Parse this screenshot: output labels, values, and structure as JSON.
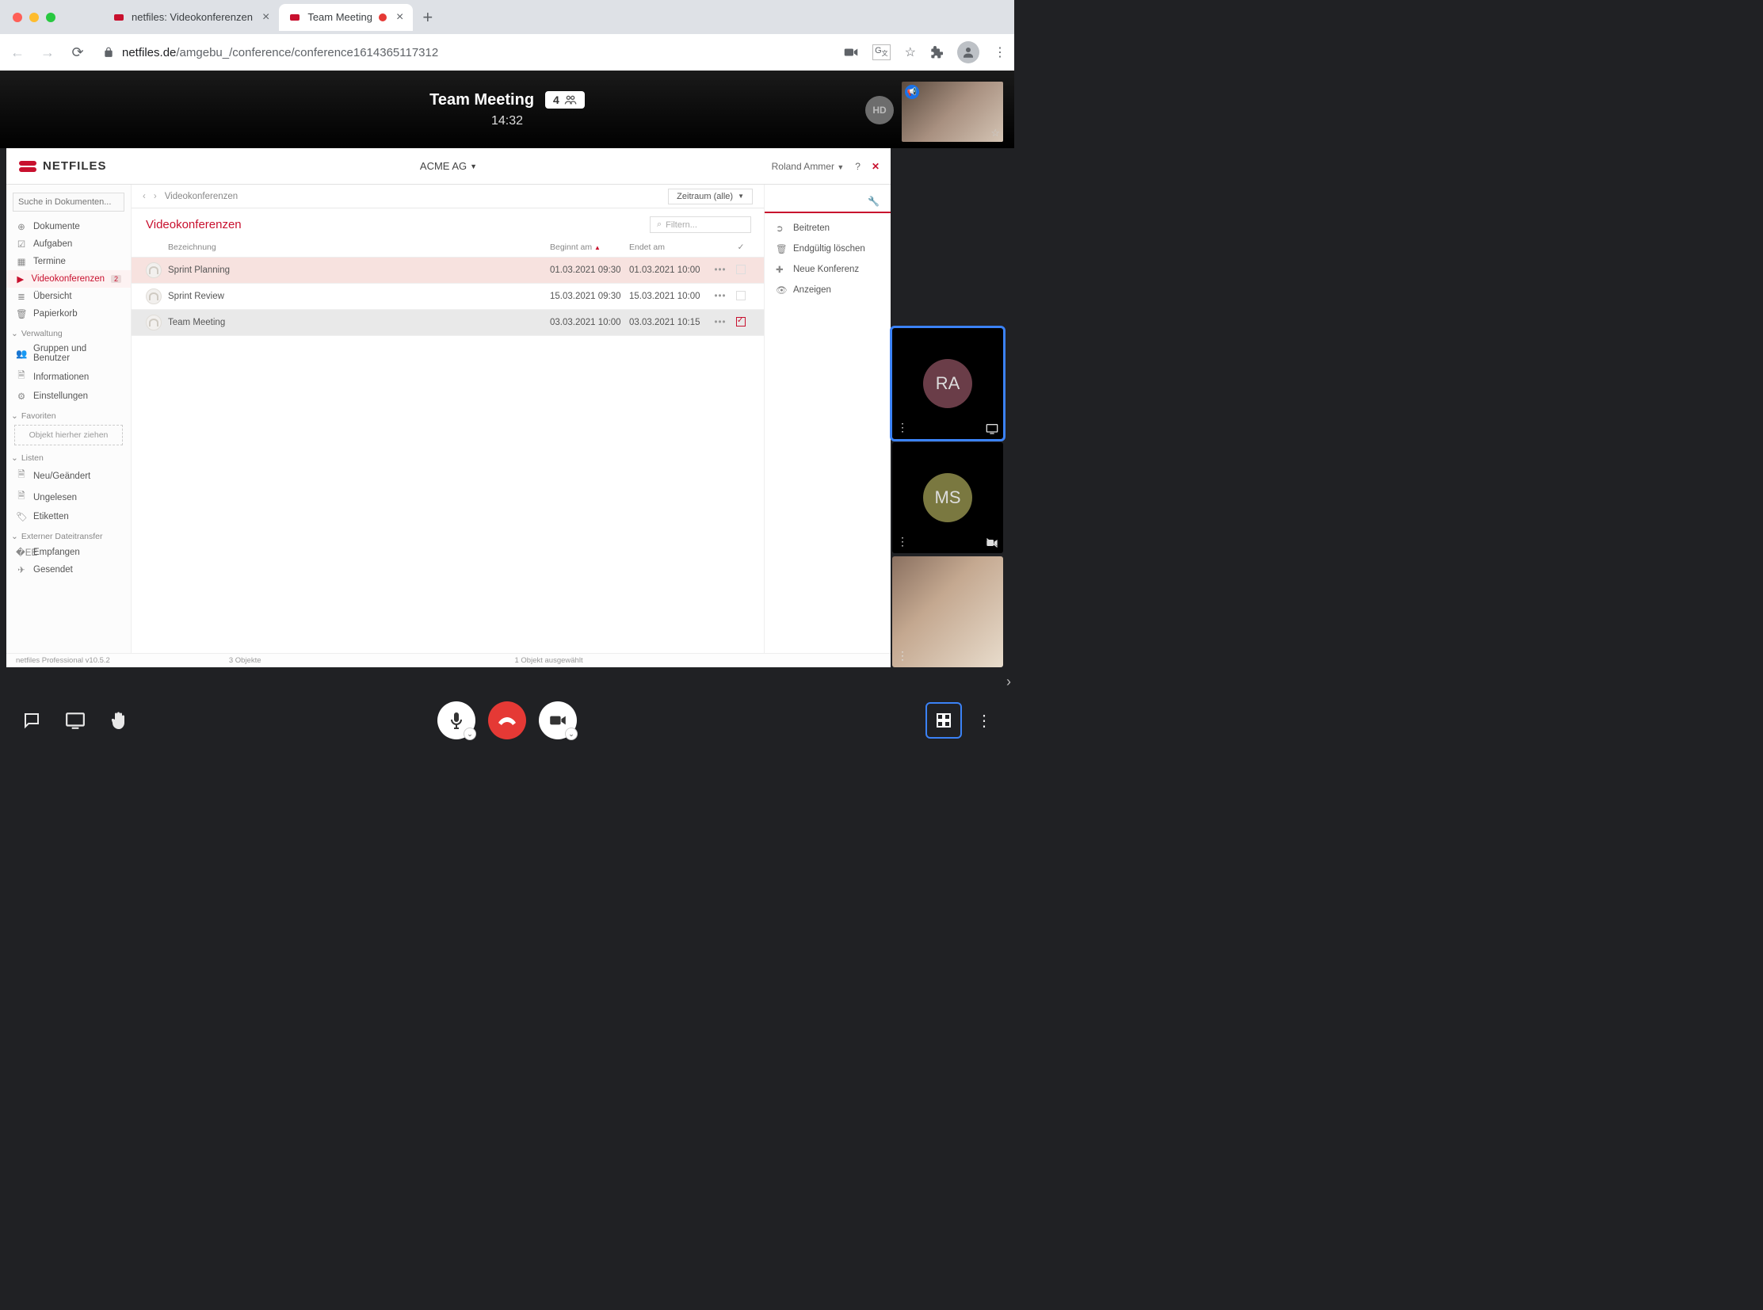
{
  "browser": {
    "tabs": [
      {
        "title": "netfiles: Videokonferenzen",
        "active": false
      },
      {
        "title": "Team Meeting",
        "active": true,
        "recording": true
      }
    ],
    "url_host": "netfiles.de",
    "url_path": "/amgebu_/conference/conference1614365117312"
  },
  "conference": {
    "title": "Team Meeting",
    "participant_count": "4",
    "elapsed": "14:32",
    "self_initials": "HD"
  },
  "app": {
    "brand": "NETFILES",
    "org": "ACME AG",
    "user": "Roland Ammer",
    "search_placeholder": "Suche in Dokumenten...",
    "nav": {
      "documents": "Dokumente",
      "tasks": "Aufgaben",
      "appointments": "Termine",
      "video": "Videokonferenzen",
      "video_badge": "2",
      "overview": "Übersicht",
      "trash": "Papierkorb"
    },
    "sections": {
      "admin": "Verwaltung",
      "admin_groups": "Gruppen und Benutzer",
      "admin_info": "Informationen",
      "admin_settings": "Einstellungen",
      "favorites": "Favoriten",
      "drop_hint": "Objekt hierher ziehen",
      "lists": "Listen",
      "lists_new": "Neu/Geändert",
      "lists_unread": "Ungelesen",
      "lists_labels": "Etiketten",
      "ext": "Externer Dateitransfer",
      "ext_recv": "Empfangen",
      "ext_sent": "Gesendet"
    },
    "breadcrumb": "Videokonferenzen",
    "period_label": "Zeitraum (alle)",
    "list_title": "Videokonferenzen",
    "filter_placeholder": "Filtern...",
    "columns": {
      "name": "Bezeichnung",
      "start": "Beginnt am",
      "end": "Endet am"
    },
    "rows": [
      {
        "name": "Sprint Planning",
        "start": "01.03.2021 09:30",
        "end": "01.03.2021 10:00",
        "selected": true,
        "checked": false
      },
      {
        "name": "Sprint Review",
        "start": "15.03.2021 09:30",
        "end": "15.03.2021 10:00",
        "selected": false,
        "checked": false
      },
      {
        "name": "Team Meeting",
        "start": "03.03.2021 10:00",
        "end": "03.03.2021 10:15",
        "selected": false,
        "checked": true,
        "hover": true
      }
    ],
    "actions": {
      "join": "Beitreten",
      "delete": "Endgültig löschen",
      "new": "Neue Konferenz",
      "show": "Anzeigen"
    },
    "status": {
      "version": "netfiles Professional v10.5.2",
      "count": "3 Objekte",
      "selected": "1 Objekt ausgewählt"
    }
  },
  "participants": [
    {
      "initials": "RA",
      "color": "#6a3d48",
      "active": true,
      "corner": "screen"
    },
    {
      "initials": "MS",
      "color": "#7a7840",
      "active": false,
      "corner": "cam-off"
    },
    {
      "initials": "",
      "video": true
    }
  ]
}
